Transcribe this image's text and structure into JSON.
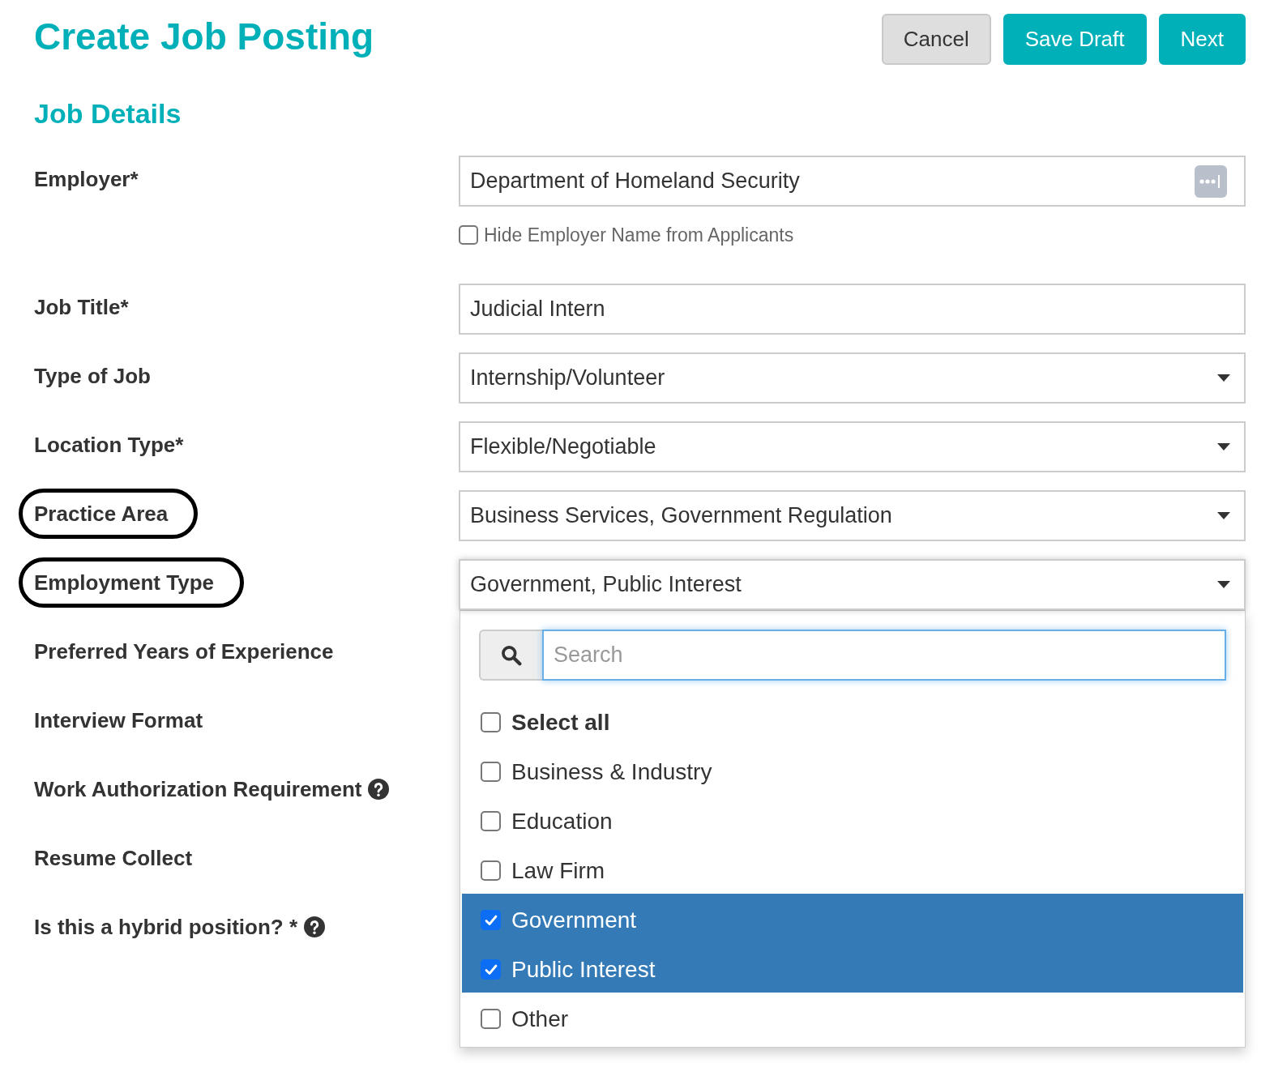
{
  "header": {
    "title": "Create Job Posting",
    "buttons": [
      {
        "label": "Cancel",
        "kind": "secondary"
      },
      {
        "label": "Save Draft",
        "kind": "primary"
      },
      {
        "label": "Next",
        "kind": "primary"
      }
    ]
  },
  "section": {
    "title": "Job Details"
  },
  "fields": [
    {
      "label": "Employer*",
      "kind": "lookup",
      "value": "Department of Homeland Security",
      "circled": false,
      "help": false,
      "option": {
        "label": "Hide Employer Name from Applicants",
        "checked": false
      }
    },
    {
      "label": "Job Title*",
      "kind": "text",
      "value": "Judicial Intern",
      "circled": false,
      "help": false
    },
    {
      "label": "Type of Job",
      "kind": "select",
      "value": "Internship/Volunteer",
      "circled": false,
      "help": false,
      "expanded": false
    },
    {
      "label": "Location Type*",
      "kind": "select",
      "value": "Flexible/Negotiable",
      "circled": false,
      "help": false,
      "expanded": false
    },
    {
      "label": "Practice Area",
      "kind": "select",
      "value": "Business Services, Government Regulation",
      "circled": true,
      "help": false,
      "expanded": false
    },
    {
      "label": "Employment Type",
      "kind": "select",
      "value": "Government, Public Interest",
      "circled": true,
      "help": false,
      "expanded": true,
      "dropdown": {
        "search": {
          "placeholder": "Search"
        },
        "options": [
          {
            "label": "Select all",
            "kind": "select_all",
            "checked": false
          },
          {
            "label": "Business & Industry",
            "kind": "option",
            "checked": false
          },
          {
            "label": "Education",
            "kind": "option",
            "checked": false
          },
          {
            "label": "Law Firm",
            "kind": "option",
            "checked": false
          },
          {
            "label": "Government",
            "kind": "option",
            "checked": true
          },
          {
            "label": "Public Interest",
            "kind": "option",
            "checked": true
          },
          {
            "label": "Other",
            "kind": "option",
            "checked": false
          }
        ]
      }
    },
    {
      "label": "Preferred Years of Experience",
      "kind": "covered",
      "circled": false,
      "help": false
    },
    {
      "label": "Interview Format",
      "kind": "covered",
      "circled": false,
      "help": false
    },
    {
      "label": "Work Authorization Requirement",
      "kind": "covered",
      "circled": false,
      "help": true
    },
    {
      "label": "Resume Collect",
      "kind": "covered",
      "circled": false,
      "help": false
    },
    {
      "label": "Is this a hybrid position? *",
      "kind": "covered",
      "circled": false,
      "help": true
    }
  ]
}
